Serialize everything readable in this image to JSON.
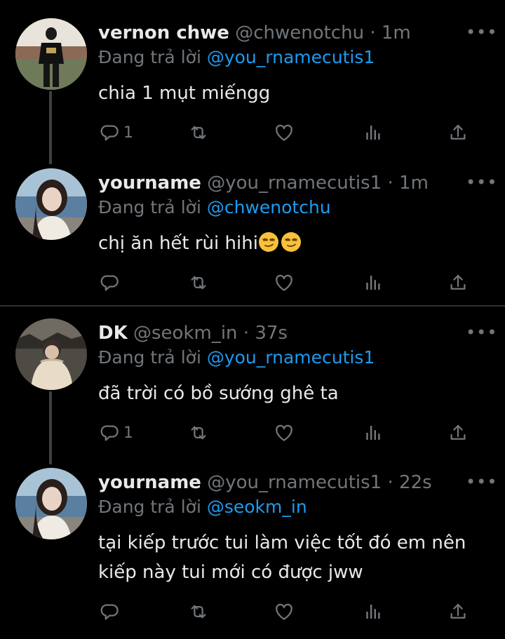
{
  "tweets": [
    {
      "name": "vernon chwe",
      "handle": "@chwenotchu",
      "time": "· 1m",
      "reply_label": "Đang trả lời",
      "reply_to": "@you_rnamecutis1",
      "text": "chia 1 mụt miếngg",
      "reply_count": "1",
      "avatar": "person-in-dark-hoodie"
    },
    {
      "name": "yourname",
      "handle": "@you_rnamecutis1",
      "time": "· 1m",
      "reply_label": "Đang trả lời",
      "reply_to": "@chwenotchu",
      "text": "chị ăn hết rùi hihi",
      "emoji": "smirk-emoji smirk-emoji",
      "reply_count": "",
      "avatar": "girl-by-sea"
    },
    {
      "name": "DK",
      "handle": "@seokm_in",
      "time": "· 37s",
      "reply_label": "Đang trả lời",
      "reply_to": "@you_rnamecutis1",
      "text": "đã trời có bồ sướng ghê ta",
      "reply_count": "1",
      "avatar": "person-in-puffer-jacket"
    },
    {
      "name": "yourname",
      "handle": "@you_rnamecutis1",
      "time": "· 22s",
      "reply_label": "Đang trả lời",
      "reply_to": "@seokm_in",
      "text_line1": "tại kiếp trước tui làm việc tốt đó em nên",
      "text_line2": "kiếp này tui mới có được jww",
      "reply_count": "",
      "avatar": "girl-by-sea"
    }
  ],
  "more_icon": "•••",
  "colors": {
    "background": "#000000",
    "text": "#e7e9ea",
    "muted": "#71767b",
    "link": "#1d9bf0",
    "divider": "#2f3336"
  }
}
